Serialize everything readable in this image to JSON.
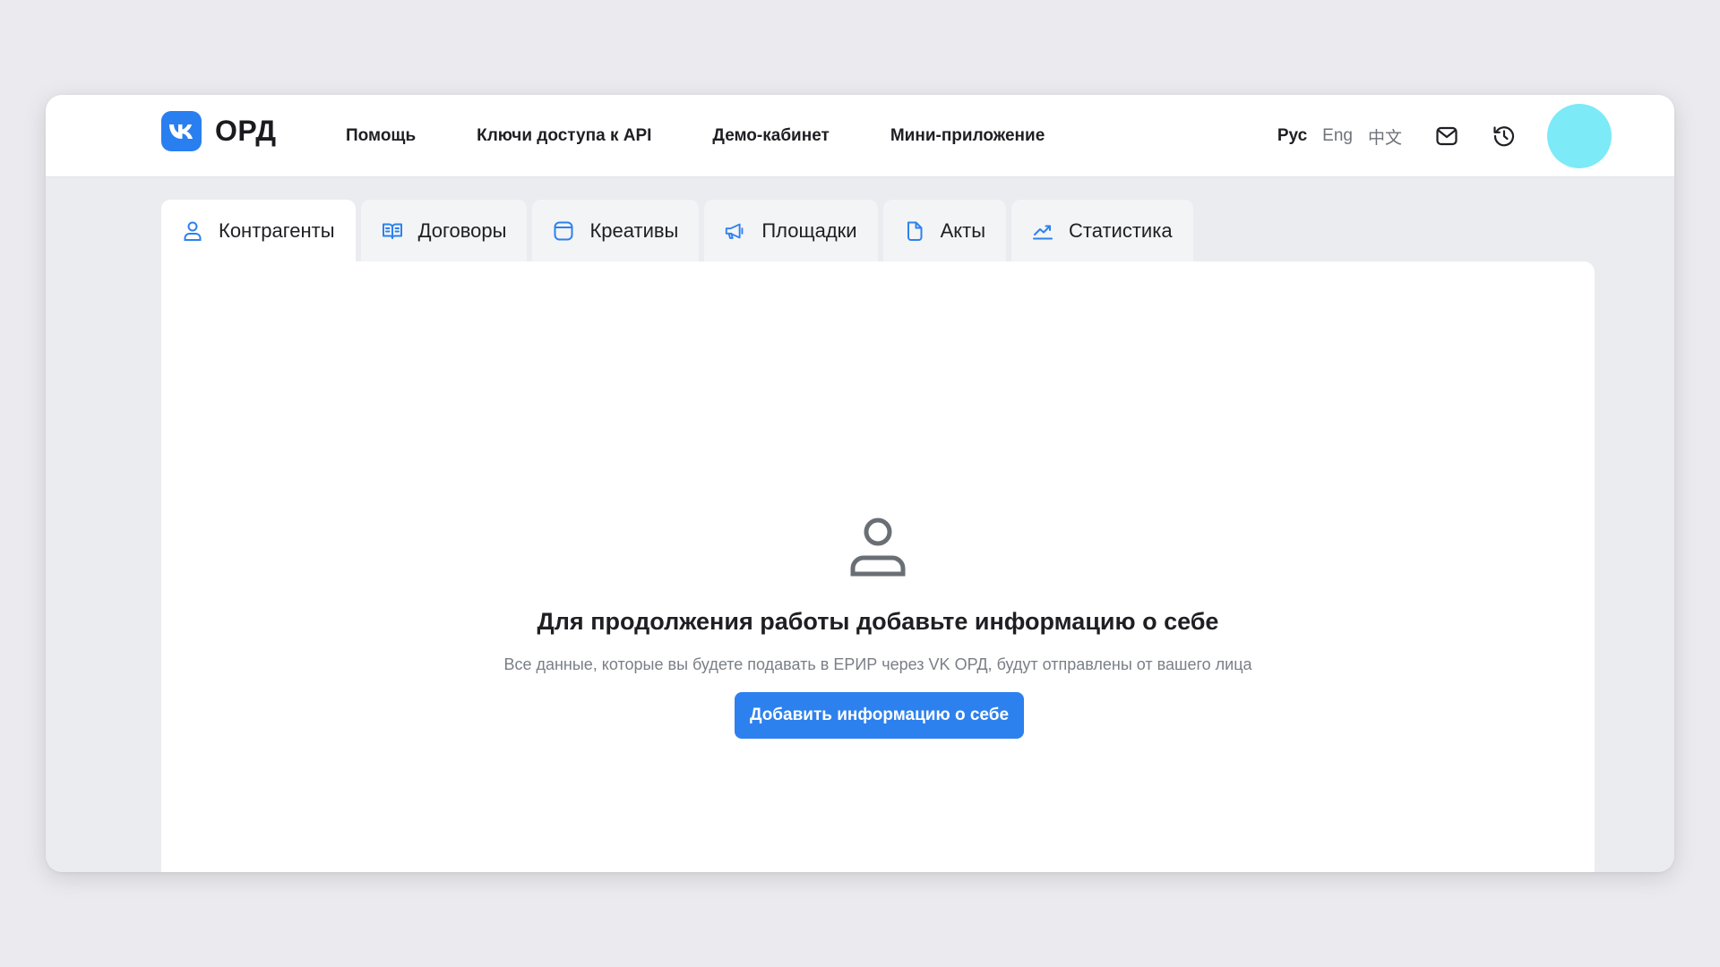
{
  "header": {
    "logo_text": "ОРД",
    "nav": [
      {
        "label": "Помощь"
      },
      {
        "label": "Ключи доступа к API"
      },
      {
        "label": "Демо-кабинет"
      },
      {
        "label": "Мини-приложение"
      }
    ],
    "languages": [
      {
        "label": "Рус",
        "active": true
      },
      {
        "label": "Eng",
        "active": false
      },
      {
        "label": "中文",
        "active": false
      }
    ],
    "icons": [
      "mail-icon",
      "history-icon"
    ],
    "avatar_color": "#7ceaf7"
  },
  "tabs": [
    {
      "label": "Контрагенты",
      "icon": "user-icon",
      "active": true
    },
    {
      "label": "Договоры",
      "icon": "book-icon",
      "active": false
    },
    {
      "label": "Креативы",
      "icon": "card-icon",
      "active": false
    },
    {
      "label": "Площадки",
      "icon": "megaphone-icon",
      "active": false
    },
    {
      "label": "Акты",
      "icon": "document-icon",
      "active": false
    },
    {
      "label": "Статистика",
      "icon": "chart-icon",
      "active": false
    }
  ],
  "empty_state": {
    "icon": "user-icon",
    "title": "Для продолжения работы добавьте информацию о себе",
    "subtitle": "Все данные, которые вы будете подавать в ЕРИР через VK ОРД, будут отправлены от вашего лица",
    "button_label": "Добавить информацию о себе"
  },
  "colors": {
    "accent": "#2d81ee",
    "vk_logo": "#2a7ff0",
    "avatar": "#7ceaf7",
    "tab_icon": "#2d81ee"
  }
}
